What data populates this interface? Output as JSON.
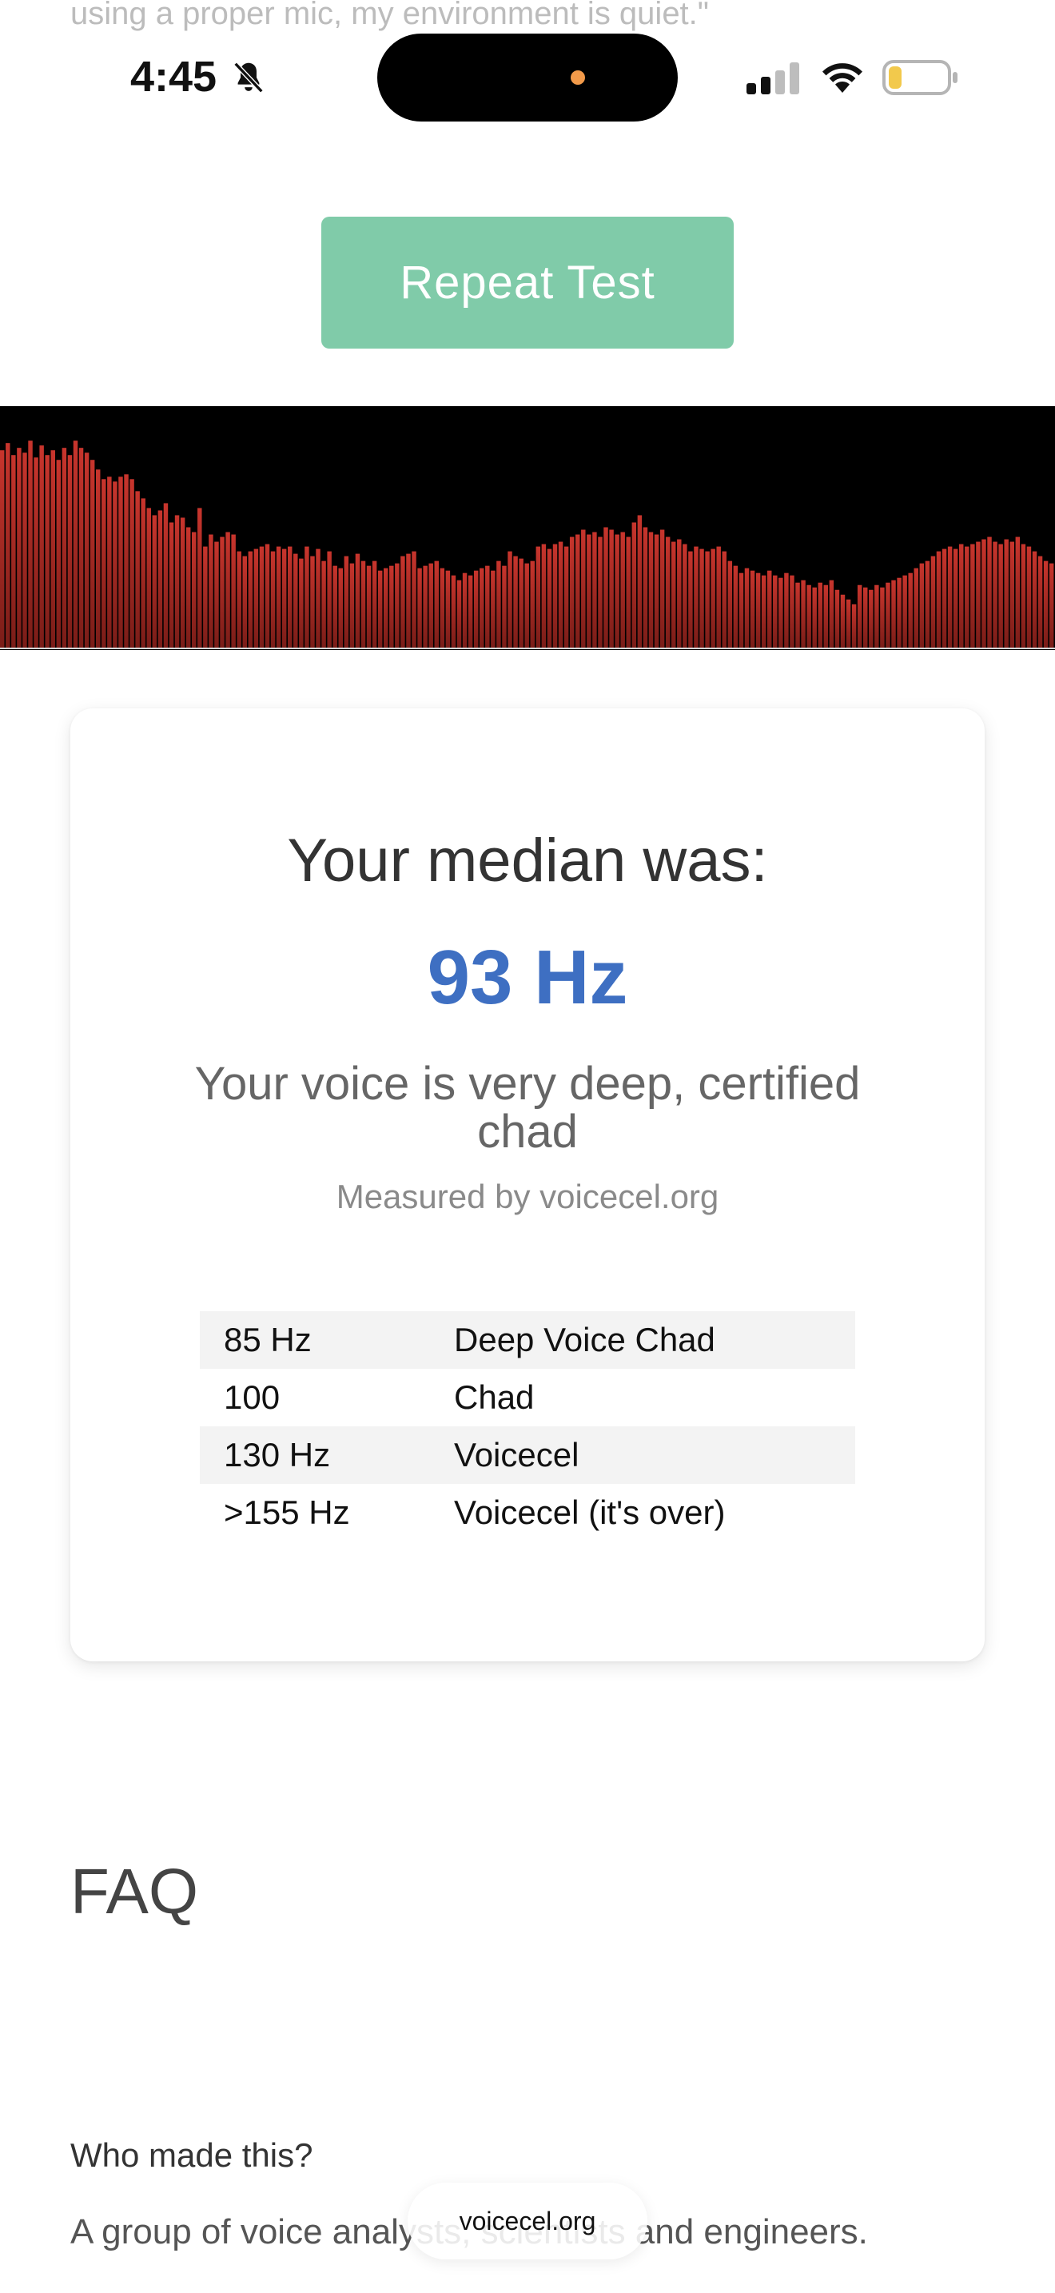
{
  "top_text": "using a proper mic, my environment is quiet.\"",
  "status_bar": {
    "time": "4:45",
    "icons": [
      "bell-slash-icon",
      "signal-icon",
      "wifi-icon",
      "battery-low-icon"
    ]
  },
  "repeat_button": {
    "label": "Repeat Test"
  },
  "visualizer": {
    "bar_color": "#c8352d",
    "levels": [
      0.82,
      0.85,
      0.8,
      0.83,
      0.81,
      0.86,
      0.79,
      0.84,
      0.8,
      0.82,
      0.78,
      0.83,
      0.8,
      0.86,
      0.83,
      0.81,
      0.78,
      0.74,
      0.7,
      0.71,
      0.69,
      0.71,
      0.72,
      0.7,
      0.65,
      0.62,
      0.58,
      0.55,
      0.57,
      0.6,
      0.52,
      0.55,
      0.54,
      0.5,
      0.48,
      0.58,
      0.42,
      0.47,
      0.44,
      0.46,
      0.48,
      0.47,
      0.4,
      0.38,
      0.4,
      0.41,
      0.42,
      0.43,
      0.4,
      0.42,
      0.41,
      0.42,
      0.39,
      0.37,
      0.42,
      0.38,
      0.41,
      0.36,
      0.4,
      0.34,
      0.33,
      0.38,
      0.35,
      0.39,
      0.36,
      0.34,
      0.36,
      0.32,
      0.33,
      0.34,
      0.35,
      0.38,
      0.39,
      0.4,
      0.33,
      0.34,
      0.35,
      0.36,
      0.33,
      0.32,
      0.3,
      0.28,
      0.31,
      0.3,
      0.32,
      0.33,
      0.34,
      0.32,
      0.36,
      0.34,
      0.4,
      0.38,
      0.37,
      0.35,
      0.36,
      0.42,
      0.43,
      0.41,
      0.43,
      0.44,
      0.42,
      0.46,
      0.47,
      0.49,
      0.47,
      0.48,
      0.46,
      0.5,
      0.49,
      0.47,
      0.48,
      0.46,
      0.52,
      0.55,
      0.5,
      0.48,
      0.47,
      0.49,
      0.46,
      0.44,
      0.45,
      0.43,
      0.4,
      0.42,
      0.41,
      0.4,
      0.41,
      0.42,
      0.4,
      0.36,
      0.34,
      0.31,
      0.33,
      0.32,
      0.31,
      0.3,
      0.32,
      0.3,
      0.29,
      0.31,
      0.3,
      0.27,
      0.28,
      0.26,
      0.25,
      0.27,
      0.26,
      0.28,
      0.24,
      0.22,
      0.2,
      0.18,
      0.26,
      0.25,
      0.24,
      0.26,
      0.25,
      0.27,
      0.28,
      0.29,
      0.3,
      0.31,
      0.33,
      0.35,
      0.36,
      0.38,
      0.4,
      0.41,
      0.42,
      0.41,
      0.43,
      0.42,
      0.43,
      0.44,
      0.45,
      0.46,
      0.44,
      0.43,
      0.45,
      0.44,
      0.46,
      0.43,
      0.42,
      0.4,
      0.38,
      0.36,
      0.35
    ]
  },
  "result": {
    "label": "Your median was:",
    "value": "93 Hz",
    "verdict": "Your voice is very deep, certified chad",
    "measured_by": "Measured by voicecel.org",
    "ranges": [
      {
        "hz": "85 Hz",
        "label": "Deep Voice Chad"
      },
      {
        "hz": "100",
        "label": "Chad"
      },
      {
        "hz": "130 Hz",
        "label": "Voicecel"
      },
      {
        "hz": ">155 Hz",
        "label": "Voicecel (it's over)"
      }
    ]
  },
  "faq": {
    "title": "FAQ",
    "items": [
      {
        "question": "Who made this?",
        "answer": "A group of voice analysts, scientists and engineers."
      }
    ]
  },
  "browser": {
    "url": "voicecel.org"
  },
  "colors": {
    "accent_button": "#80cba9",
    "median_value": "#3e6fc2",
    "table_stripe": "#f3f3f3"
  }
}
